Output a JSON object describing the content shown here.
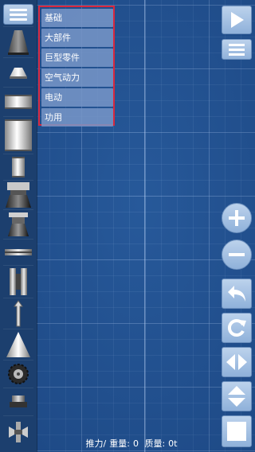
{
  "categories": [
    "基础",
    "大部件",
    "巨型零件",
    "空气动力",
    "电动",
    "功用"
  ],
  "status": {
    "thrust_label": "推力/",
    "weight_label": "重量:",
    "weight_value": "0",
    "mass_label": "质量:",
    "mass_value": "0t"
  },
  "parts": [
    "capsule-nose-part",
    "small-capsule-part",
    "fuel-tank-short-part",
    "fuel-tank-tall-part",
    "fuel-tank-thin-part",
    "rocket-engine-large-part",
    "rocket-engine-small-part",
    "separator-part",
    "side-booster-part",
    "strut-part",
    "nose-cone-part",
    "wheel-part",
    "docking-port-part",
    "fan-part"
  ],
  "icons": {
    "menu": "hamburger-icon",
    "play": "play-icon",
    "list": "list-icon",
    "zoom_in": "plus-icon",
    "zoom_out": "minus-icon",
    "undo": "undo-icon",
    "redo": "redo-icon",
    "flip_h": "flip-horizontal-icon",
    "flip_v": "flip-vertical-icon",
    "select": "square-icon"
  },
  "colors": {
    "background": "#27599a",
    "highlight": "#d8283e",
    "button": "#a8c2e4"
  }
}
